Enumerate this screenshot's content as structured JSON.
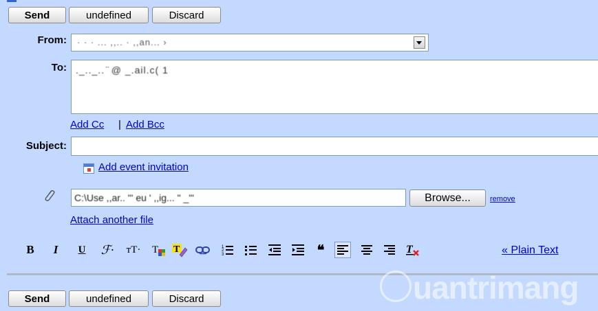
{
  "toolbar_top": {
    "send": "Send",
    "undefined": "undefined",
    "discard": "Discard"
  },
  "toolbar_bottom": {
    "send": "Send",
    "undefined": "undefined",
    "discard": "Discard"
  },
  "from": {
    "label": "From:",
    "value": "· · ·  ...  ,,..  ·  ,,an... ›"
  },
  "to": {
    "label": "To:",
    "value": "._.._.. ̈ @ _.ail.c( 1"
  },
  "cc_bcc": {
    "add_cc": "Add Cc",
    "separator": "|",
    "add_bcc": "Add Bcc"
  },
  "subject": {
    "label": "Subject:",
    "value": ""
  },
  "event": {
    "label": "Add event invitation"
  },
  "attachment": {
    "path": "C:\\Use  ,,ar.. \"'  eu  ' ,,ig... \"  _'\"",
    "browse": "Browse...",
    "remove": "remove",
    "attach_another": "Attach another file"
  },
  "format": {
    "bold": "B",
    "italic": "I",
    "underline": "U",
    "font": "ℱ·",
    "size": "тT·",
    "quote": "❝",
    "plain_text": "« Plain Text"
  },
  "watermark": "uantrimang"
}
